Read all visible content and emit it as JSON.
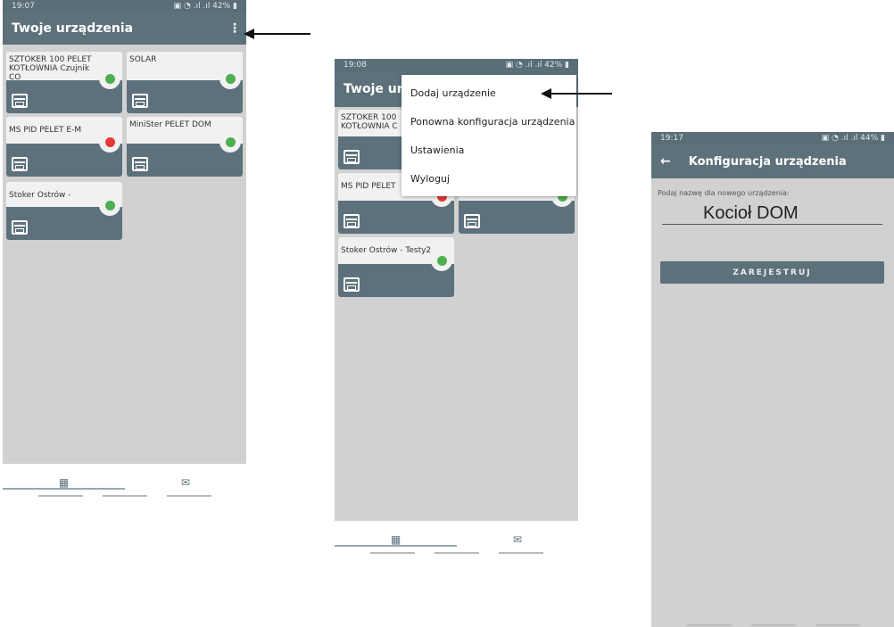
{
  "screen1": {
    "status_time": "19:07",
    "status_icons": "▣ ◔ .ıl .ıl 42% ▮",
    "title": "Twoje urządzenia",
    "menu_icon": "⋮",
    "tiles": [
      {
        "name": "SZTOKER 100 PELET KOTŁOWNIA Czujnik CO",
        "status": "ok"
      },
      {
        "name": "SOLAR",
        "status": "ok"
      },
      {
        "name": "MS PID PELET E-M",
        "status": "error"
      },
      {
        "name": "MiniSter PELET DOM",
        "status": "ok"
      },
      {
        "name": "Stoker Ostrów -",
        "status": "ok"
      }
    ],
    "nav": {
      "devices_icon": "calendar-icon",
      "messages_icon": "mail-icon"
    }
  },
  "screen2": {
    "status_time": "19:08",
    "status_icons": "▣ ◔ .ıl .ıl 42% ▮",
    "title": "Twoje urz",
    "tiles": [
      {
        "name": "SZTOKER 100 KOTŁOWNIA C"
      },
      {
        "name": "MS PID PELET"
      },
      {
        "name": "Stoker Ostrów - Testy2"
      }
    ],
    "menu": [
      "Dodaj urządzenie",
      "Ponowna konfiguracja urządzenia",
      "Ustawienia",
      "Wyloguj"
    ]
  },
  "screen3": {
    "status_time": "19:17",
    "status_icons": "▣ ◔ .ıl .ıl 44% ▮",
    "back_icon": "←",
    "title": "Konfiguracja urządzenia",
    "field_label": "Podaj nazwę dla nowego urządzenia:",
    "field_value": "Kocioł DOM",
    "register_button": "ZAREJESTRUJ"
  },
  "colors": {
    "appbar": "#5d717b",
    "tile_band": "#5c717c",
    "ok": "#4caf50",
    "error": "#e53935",
    "background": "#d1d1d1"
  }
}
